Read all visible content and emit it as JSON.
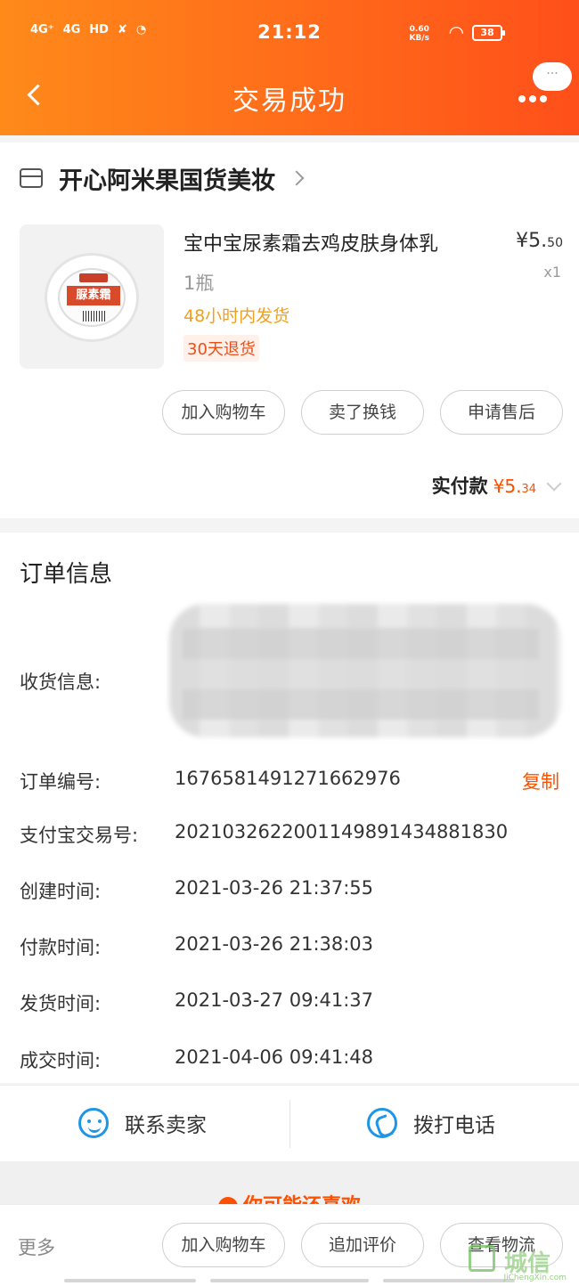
{
  "status_bar": {
    "network_1": "4G⁺",
    "network_2": "4G",
    "hd": "HD",
    "time": "21:12",
    "speed_value": "0.60",
    "speed_unit": "KB/s",
    "battery": "38"
  },
  "header": {
    "title": "交易成功",
    "bubble": "···"
  },
  "store": {
    "name": "开心阿米果国货美妆"
  },
  "product": {
    "jar_label": "脲素霜",
    "title": "宝中宝尿素霜去鸡皮肤身体乳",
    "price_main": "¥5.",
    "price_cents": "50",
    "qty": "x1",
    "spec": "1瓶",
    "shipping": "48小时内发货",
    "return_policy": "30天退货",
    "actions": [
      "加入购物车",
      "卖了换钱",
      "申请售后"
    ]
  },
  "payment": {
    "label": "实付款",
    "amount_main": "¥5.",
    "amount_cents": "34"
  },
  "order_info": {
    "title": "订单信息",
    "shipping_label": "收货信息:",
    "order_no_label": "订单编号:",
    "order_no": "1676581491271662976",
    "copy": "复制",
    "alipay_label": "支付宝交易号:",
    "alipay_no": "2021032622001149891434881830",
    "created_label": "创建时间:",
    "created": "2021-03-26 21:37:55",
    "paid_label": "付款时间:",
    "paid": "2021-03-26 21:38:03",
    "shipped_label": "发货时间:",
    "shipped": "2021-03-27 09:41:37",
    "completed_label": "成交时间:",
    "completed": "2021-04-06 09:41:48"
  },
  "contact": {
    "seller": "联系卖家",
    "phone": "拨打电话"
  },
  "recommend": {
    "text": "你可能还喜欢"
  },
  "bottom_bar": {
    "more": "更多",
    "actions": [
      "加入购物车",
      "追加评价",
      "查看物流"
    ]
  },
  "watermark": {
    "text": "城信",
    "sub": "JiChengXin.com"
  },
  "colors": {
    "header_orange": "#ff6a1a",
    "accent": "#ff5000",
    "ship_text": "#f0a020",
    "contact_blue": "#1e96e6"
  }
}
